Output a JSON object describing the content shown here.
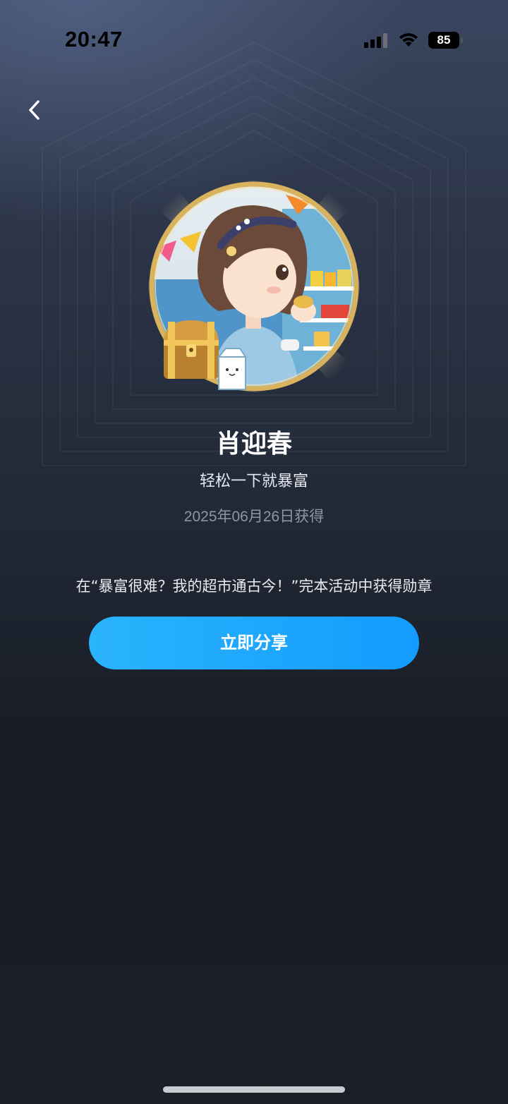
{
  "status_bar": {
    "time": "20:47",
    "battery_level": "85",
    "icons": [
      "signal-icon",
      "wifi-icon",
      "battery-icon"
    ]
  },
  "nav": {
    "back_icon": "chevron-left-icon"
  },
  "badge": {
    "image": "badge-illustration",
    "title": "肖迎春",
    "subtitle": "轻松一下就暴富",
    "date_earned": "2025年06月26日获得",
    "description": "在“暴富很难？我的超市通古今！”完本活动中获得勋章"
  },
  "actions": {
    "share_label": "立即分享"
  },
  "colors": {
    "share_button": "#1aa7ff",
    "badge_ring": "#d8b25c",
    "background_top": "#3a4660",
    "background_bottom": "#171b22"
  }
}
